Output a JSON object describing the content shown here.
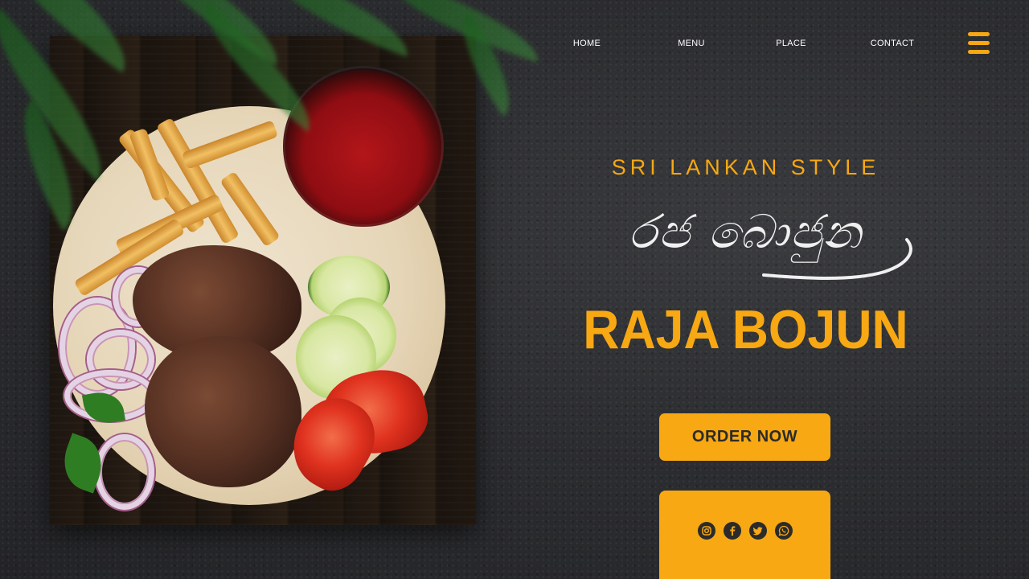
{
  "nav": {
    "items": [
      {
        "label": "HOME"
      },
      {
        "label": "MENU"
      },
      {
        "label": "PLACE"
      },
      {
        "label": "CONTACT"
      }
    ],
    "menu_icon": "hamburger-menu-icon"
  },
  "hero": {
    "subtitle": "SRI LANKAN STYLE",
    "sinhala_title": "රජ බොජුන",
    "title": "RAJA BOJUN",
    "order_button": "ORDER NOW"
  },
  "social": {
    "icons": [
      "instagram-icon",
      "facebook-icon",
      "twitter-icon",
      "whatsapp-icon"
    ]
  },
  "colors": {
    "accent": "#f7a812",
    "background": "#2c2d30",
    "button_text": "#2b2b2b",
    "nav_text": "#ffffff"
  }
}
